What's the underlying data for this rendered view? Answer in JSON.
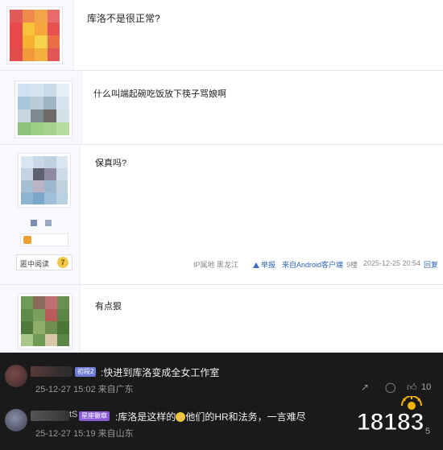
{
  "posts": [
    {
      "text": "库洛不是很正常?"
    },
    {
      "text": "什么叫端起碗吃饭放下筷子骂娘啊"
    },
    {
      "text": "保真吗?",
      "level_label": "匿中阅读",
      "level_num": "7",
      "meta": {
        "ip": "IP属地 黑龙江",
        "report": "举报",
        "client": "来自Android客户端",
        "floor": "9楼",
        "time": "2025-12-25 20:54",
        "reply": "回复"
      }
    },
    {
      "text": "有点狠"
    }
  ],
  "comments": [
    {
      "tag": "初段2",
      "tag_color": "#6b7bd6",
      "text": ":快进到库洛变成全女工作室",
      "date": "25-12-27 15:02 来自广东",
      "likes": "10"
    },
    {
      "name_suffix": "tS",
      "tag": "星座徽章",
      "tag_color": "#8a5cd6",
      "text_before": ":库洛是这样的",
      "text_after": "他们的HR和法务，一言难尽",
      "date": "25-12-27 15:19 来自山东",
      "likes": "5"
    }
  ],
  "watermark": {
    "text": "18183"
  },
  "colors": {
    "dark_bg": "#1a1a1a",
    "link": "#2d64b3"
  }
}
